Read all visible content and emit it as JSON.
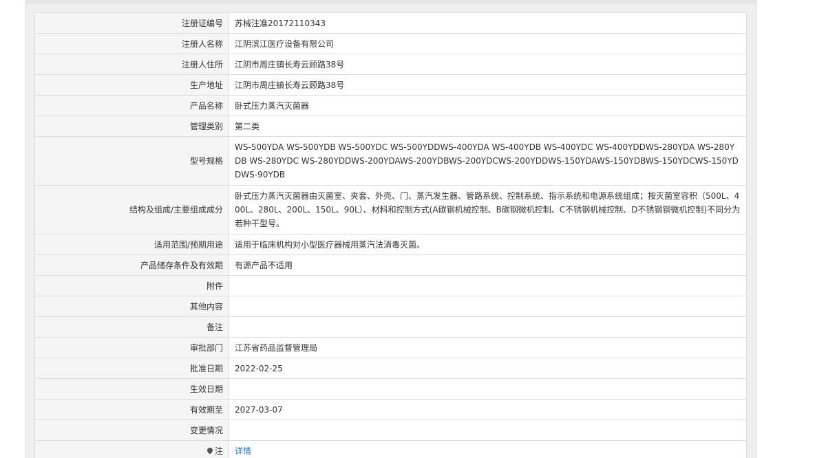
{
  "rows": [
    {
      "label": "注册证编号",
      "value": "苏械注准20172110343"
    },
    {
      "label": "注册人名称",
      "value": "江阴滨江医疗设备有限公司"
    },
    {
      "label": "注册人住所",
      "value": "江阴市周庄镇长寿云顾路38号"
    },
    {
      "label": "生产地址",
      "value": "江阴市周庄镇长寿云顾路38号"
    },
    {
      "label": "产品名称",
      "value": "卧式压力蒸汽灭菌器"
    },
    {
      "label": "管理类别",
      "value": "第二类"
    },
    {
      "label": "型号规格",
      "value": "WS-500YDA WS-500YDB WS-500YDC WS-500YDDWS-400YDA WS-400YDB WS-400YDC WS-400YDDWS-280YDA WS-280YDB WS-280YDC WS-280YDDWS-200YDAWS-200YDBWS-200YDCWS-200YDDWS-150YDAWS-150YDBWS-150YDCWS-150YDDWS-90YDB"
    },
    {
      "label": "结构及组成/主要组成成分",
      "value": "卧式压力蒸汽灭菌器由灭菌室、夹套、外壳、门、蒸汽发生器、管路系统、控制系统、指示系统和电源系统组成；按灭菌室容积（500L、400L、280L、200L、150L、90L）、材料和控制方式(A碳钢机械控制、B碳钢微机控制、C不锈钢机械控制、D不锈钢钢微机控制)不同分为若种干型号。"
    },
    {
      "label": "适用范围/预期用途",
      "value": "适用于临床机构对小型医疗器械用蒸汽法消毒灭菌。"
    },
    {
      "label": "产品储存条件及有效期",
      "value": "有源产品不适用"
    },
    {
      "label": "附件",
      "value": ""
    },
    {
      "label": "其他内容",
      "value": ""
    },
    {
      "label": "备注",
      "value": ""
    },
    {
      "label": "审批部门",
      "value": "江苏省药品监督管理局"
    },
    {
      "label": "批准日期",
      "value": "2022-02-25"
    },
    {
      "label": "生效日期",
      "value": ""
    },
    {
      "label": "有效期至",
      "value": "2027-03-07"
    },
    {
      "label": "变更情况",
      "value": ""
    },
    {
      "label": "注",
      "value": "详情"
    }
  ]
}
